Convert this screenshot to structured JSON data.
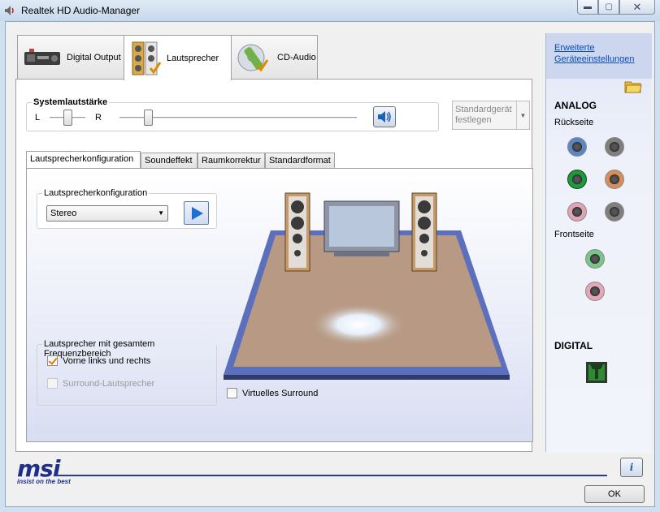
{
  "window": {
    "title": "Realtek HD Audio-Manager"
  },
  "top_tabs": [
    {
      "label": "Digital Output",
      "icon": "digital-output-device-icon"
    },
    {
      "label": "Lautsprecher",
      "icon": "speaker-icon",
      "active": true
    },
    {
      "label": "CD-Audio",
      "icon": "cd-audio-icon"
    }
  ],
  "volume": {
    "label": "Systemlautstärke",
    "left_label": "L",
    "right_label": "R",
    "balance": 0.5,
    "level": 0.12
  },
  "default_device": {
    "label_line1": "Standardgerät",
    "label_line2": "festlegen"
  },
  "sub_tabs": [
    {
      "label": "Lautsprecherkonfiguration",
      "active": true
    },
    {
      "label": "Soundeffekt"
    },
    {
      "label": "Raumkorrektur"
    },
    {
      "label": "Standardformat"
    }
  ],
  "config": {
    "group_label": "Lautsprecherkonfiguration",
    "selected": "Stereo"
  },
  "fullrange": {
    "group_label": "Lautsprecher mit gesamtem Frequenzbereich",
    "front_label": "Vorne links und rechts",
    "front_checked": true,
    "surround_label": "Surround-Lautsprecher",
    "surround_checked": false
  },
  "virtual_surround": {
    "label": "Virtuelles Surround",
    "checked": false
  },
  "side": {
    "link_line1": "Erweiterte",
    "link_line2": "Geräteeinstellungen",
    "analog_title": "ANALOG",
    "rear_label": "Rückseite",
    "front_label": "Frontseite",
    "digital_title": "DIGITAL"
  },
  "branding": {
    "logo": "msi",
    "slogan": "insist on the best"
  },
  "buttons": {
    "ok": "OK"
  },
  "colors": {
    "jack_blue": "#5b86c4",
    "jack_gray": "#7f7f7f",
    "jack_green": "#1f9a3a",
    "jack_orange": "#d98d5c",
    "jack_pink": "#e2a3b5",
    "jack_green_front": "#79c68a",
    "jack_pink_front": "#e6a6b7",
    "accent": "#1f2f88"
  }
}
